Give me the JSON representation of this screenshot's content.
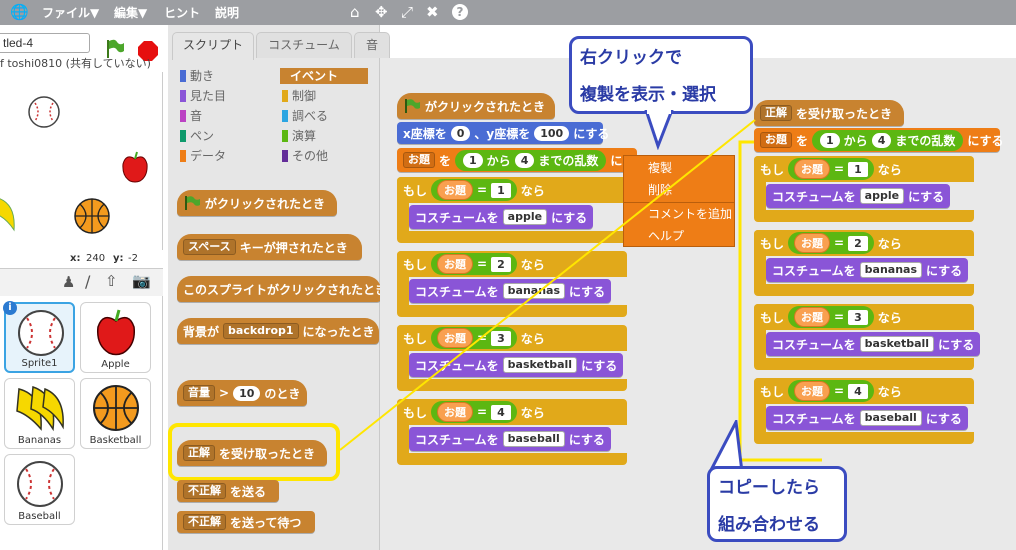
{
  "menubar": {
    "file": "ファイル▼",
    "edit": "編集▼",
    "hint": "ヒント",
    "about": "説明"
  },
  "stage": {
    "project_title": "tled-4",
    "byline": "f toshi0810 (共有していない)",
    "coords_x_label": "x:",
    "coords_x": "240",
    "coords_y_label": "y:",
    "coords_y": "-2"
  },
  "sprites": [
    {
      "name": "Sprite1",
      "icon": "baseball-icon"
    },
    {
      "name": "Apple",
      "icon": "apple-icon"
    },
    {
      "name": "Bananas",
      "icon": "bananas-icon"
    },
    {
      "name": "Basketball",
      "icon": "basketball-icon"
    },
    {
      "name": "Baseball",
      "icon": "baseball-icon"
    }
  ],
  "tabs": [
    "スクリプト",
    "コスチューム",
    "音"
  ],
  "categories": {
    "motion": "動き",
    "looks": "見た目",
    "sound": "音",
    "pen": "ペン",
    "data": "データ",
    "events": "イベント",
    "control": "制御",
    "sensing": "調べる",
    "operators": "演算",
    "more": "その他"
  },
  "palette_blocks": {
    "flag_clicked": "がクリックされたとき",
    "key_pressed_key": "スペース",
    "key_pressed": "キーが押されたとき",
    "sprite_clicked": "このスプライトがクリックされたとき",
    "backdrop_prefix": "背景が",
    "backdrop_value": "backdrop1",
    "backdrop_suffix": "になったとき",
    "volume_label": "音量",
    "volume_gt": ">",
    "volume_value": "10",
    "volume_suffix": "のとき",
    "receive_value": "正解",
    "receive_suffix": "を受け取ったとき",
    "broadcast_value": "不正解",
    "broadcast_suffix": "を送る",
    "broadcast_wait_value": "不正解",
    "broadcast_wait_suffix": "を送って待つ"
  },
  "script1": {
    "hat": "がクリックされたとき",
    "goto_prefix": "x座標を",
    "goto_x": "0",
    "goto_mid": "、y座標を",
    "goto_y": "100",
    "goto_suffix": "にする",
    "set_var": "お題",
    "set_wo": "を",
    "rand_from": "1",
    "rand_mid": "から",
    "rand_to": "4",
    "rand_suffix": "までの乱数",
    "set_suffix": "にする",
    "if_label": "もし",
    "then_label": "なら",
    "var_name": "お題",
    "eq": "=",
    "costume_prefix": "コスチュームを",
    "costume_suffix": "にする",
    "cases": [
      {
        "n": "1",
        "costume": "apple"
      },
      {
        "n": "2",
        "costume": "bananas"
      },
      {
        "n": "3",
        "costume": "basketball"
      },
      {
        "n": "4",
        "costume": "baseball"
      }
    ]
  },
  "script2": {
    "receive_value": "正解",
    "receive_suffix": "を受け取ったとき",
    "set_var": "お題",
    "set_wo": "を",
    "rand_from": "1",
    "rand_mid": "から",
    "rand_to": "4",
    "rand_suffix": "までの乱数",
    "set_suffix": "にする",
    "if_label": "もし",
    "then_label": "なら",
    "var_name": "お題",
    "eq": "=",
    "costume_prefix": "コスチュームを",
    "costume_suffix": "にする",
    "cases": [
      {
        "n": "1",
        "costume": "apple"
      },
      {
        "n": "2",
        "costume": "bananas"
      },
      {
        "n": "3",
        "costume": "basketball"
      },
      {
        "n": "4",
        "costume": "baseball"
      }
    ]
  },
  "context_menu": {
    "duplicate": "複製",
    "delete": "削除",
    "add_comment": "コメントを追加",
    "help": "ヘルプ"
  },
  "callouts": {
    "top_line1": "右クリックで",
    "top_line2": "複製を表示・選択",
    "bottom_line1": "コピーしたら",
    "bottom_line2": "組み合わせる"
  },
  "colors": {
    "highlight": "#ffe600",
    "callout_border": "#3b4cc0",
    "events": "#c88330",
    "control": "#e1a91a",
    "operators": "#5cb712",
    "looks": "#8a55d7",
    "data": "#ee7d16",
    "motion": "#4a6cd4"
  }
}
